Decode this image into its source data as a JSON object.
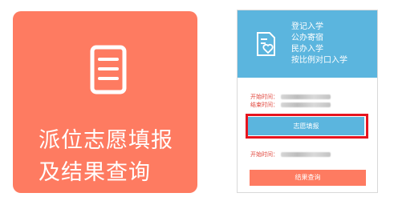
{
  "left_tile": {
    "icon": "document-list-icon",
    "title": "派位志愿填报\n及结果查询"
  },
  "panel": {
    "icon": "heart-document-icon",
    "categories": [
      "登记入学",
      "公办寄宿",
      "民办入学",
      "按比例对口入学"
    ],
    "apply_times": {
      "start_label": "开始时间：",
      "end_label": "结束时间："
    },
    "apply_button": "志愿填报",
    "result_times": {
      "start_label": "开始时间："
    },
    "result_button": "结果查询"
  },
  "colors": {
    "tile_bg": "#fe7b61",
    "panel_header_bg": "#5bb5de",
    "highlight_border": "#e6141e",
    "time_label": "#e0443a"
  }
}
